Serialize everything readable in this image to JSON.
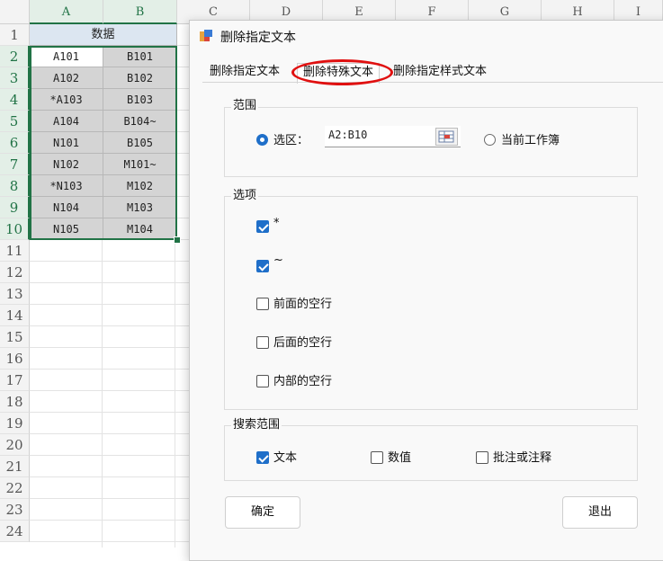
{
  "spreadsheet": {
    "columns": [
      "A",
      "B",
      "C",
      "D",
      "E",
      "F",
      "G",
      "H",
      "I"
    ],
    "rows": [
      "1",
      "2",
      "3",
      "4",
      "5",
      "6",
      "7",
      "8",
      "9",
      "10",
      "11",
      "12",
      "13",
      "14",
      "15",
      "16",
      "17",
      "18",
      "19",
      "20",
      "21",
      "22",
      "23",
      "24"
    ],
    "header_cell": "数据",
    "col_a": [
      "A101",
      "A102",
      "*A103",
      "A104",
      "N101",
      "N102",
      "*N103",
      "N104",
      "N105"
    ],
    "col_b": [
      "B101",
      "B102",
      "B103",
      "B104~",
      "B105",
      "M101~",
      "M102",
      "M103",
      "M104"
    ]
  },
  "dialog": {
    "title": "删除指定文本",
    "tabs": [
      "删除指定文本",
      "删除特殊文本",
      "删除指定样式文本"
    ],
    "range_group": {
      "label": "范围",
      "selection_label": "选区：",
      "selection_value": "A2:B10",
      "workbook_label": "当前工作簿"
    },
    "options_group": {
      "label": "选项",
      "items": [
        {
          "label": "*",
          "checked": true
        },
        {
          "label": "~",
          "checked": true
        },
        {
          "label": "前面的空行",
          "checked": false
        },
        {
          "label": "后面的空行",
          "checked": false
        },
        {
          "label": "内部的空行",
          "checked": false
        }
      ]
    },
    "search_group": {
      "label": "搜索范围",
      "items": [
        {
          "label": "文本",
          "checked": true
        },
        {
          "label": "数值",
          "checked": false
        },
        {
          "label": "批注或注释",
          "checked": false
        }
      ]
    },
    "ok_label": "确定",
    "exit_label": "退出"
  },
  "colors": {
    "accent": "#1f6fc9",
    "highlight": "#e01010",
    "excel_green": "#217346"
  }
}
